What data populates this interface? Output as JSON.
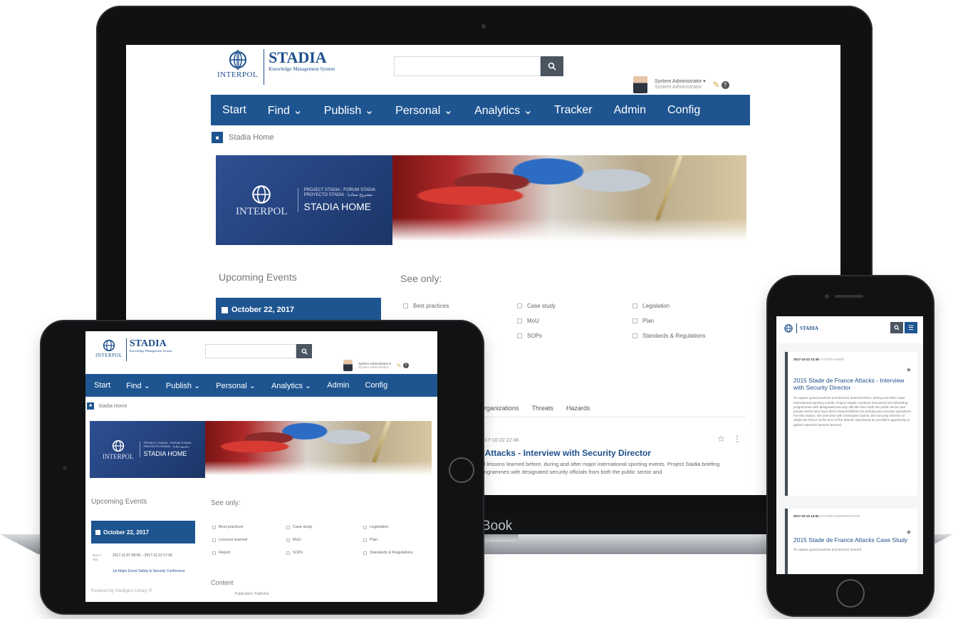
{
  "brand": {
    "emblem_word": "INTERPOL",
    "title": "STADIA",
    "subtitle": "Knowledge Management System"
  },
  "user": {
    "name": "System Administrator ▾",
    "role": "System Administrator"
  },
  "nav": {
    "laptop": [
      "Start",
      "Find ⌄",
      "Publish ⌄",
      "Personal ⌄",
      "Analytics ⌄",
      "Tracker",
      "Admin",
      "Config"
    ],
    "tablet": [
      "Start",
      "Find ⌄",
      "Publish ⌄",
      "Personal ⌄",
      "Analytics ⌄",
      "Admin",
      "Config"
    ]
  },
  "breadcrumb": "Stadia Home",
  "banner": {
    "line1": "PROJECT STADIA - FORUM STADIA",
    "line2": "PROYECTO STADIA · مشروع ستاديا",
    "title": "STADIA HOME"
  },
  "events": {
    "title": "Upcoming Events",
    "date": "October 22, 2017",
    "tablet_date": "October 22, 2017",
    "tablet_range": "2017-11-07 09:00 – 2017-11-10 17:00",
    "tablet_event": "1st Major Event Safety & Security Conference",
    "tablet_day": "Nov 7 Tue"
  },
  "filters": {
    "title": "See only:",
    "laptop": [
      "Best practices",
      "Case study",
      "Legislation",
      "",
      "MoU",
      "Plan",
      "",
      "SOPs",
      "Standards & Regulations"
    ],
    "tablet": [
      "Best practices",
      "Case study",
      "Legislation",
      "Lessons learned",
      "MoU",
      "Plan",
      "Report",
      "SOPs",
      "Standards & Regulations"
    ]
  },
  "tabs": [
    "Organizations",
    "Threats",
    "Hazards"
  ],
  "post": {
    "meta": "2017-10-22 22:48",
    "title": "e Attacks - Interview with Security Director",
    "text": "od lessons learned before, during and after major international sporting events. Project Stadia briefing programmes with designated security officials from both the public sector and"
  },
  "tablet_footer": {
    "powered": "Powered by Intelligent Library ®",
    "content": "Content",
    "pubtype": "Publication: Publisher"
  },
  "laptop_brand": "Book",
  "phone": {
    "cards": [
      {
        "meta": "2017-10-22 22:48",
        "meta_muted": "SYSTEM ADMIN",
        "title": "2015 Stade de France Attacks - Interview with Security Director",
        "text": "To capture good practices and lessons learned before, during and after major international sporting events, Project Stadia conducts structured and debriefing programmes with designated security officials from both the public sector and private sector who have direct responsibilities for policing and security operations. For this reason, the interview with Christophe Dulme, the Security Director of Stade de France at the time of the attacks represents an excellent opportunity to gather important lessons learned."
      },
      {
        "meta": "2017-10-19 14:52",
        "meta_muted": "SYSTEM ADMINISTRATOR",
        "title": "2015 Stade de France Attacks Case Study",
        "text": "To capture good practices and lessons learned"
      }
    ]
  },
  "colors": {
    "nav": "#1e5591",
    "brand": "#1d4f8c",
    "search_button": "#4a5560"
  },
  "icons": {
    "search": "search-icon",
    "menu": "menu-icon",
    "star": "star-icon",
    "more": "more-vertical-icon",
    "home": "home-icon",
    "calendar": "calendar-icon",
    "help": "help-icon",
    "notes": "notes-icon"
  }
}
